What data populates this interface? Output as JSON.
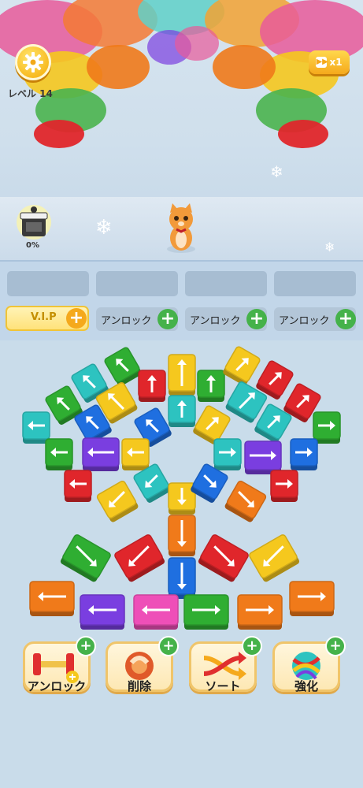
{
  "hud": {
    "settings_icon": "gear-icon",
    "level_label": "レベル 14",
    "speed_label": "x1",
    "speed_icon": "fast-forward-icon",
    "shop_progress": "0%"
  },
  "slots": {
    "count": 4,
    "vip_label": "V.I.P",
    "unlock_label": "アンロック",
    "unlock_buttons": 3
  },
  "tools": [
    {
      "label": "アンロック",
      "icon": "dumbbell-plus-icon"
    },
    {
      "label": "削除",
      "icon": "hand-pointer-icon"
    },
    {
      "label": "ソート",
      "icon": "shuffle-icon"
    },
    {
      "label": "強化",
      "icon": "yarn-ball-icon"
    }
  ],
  "colors": {
    "red": "#e0262b",
    "yellow": "#f5c81e",
    "green": "#2fae32",
    "teal": "#2dc3c0",
    "blue": "#1f6fe0",
    "purple": "#7a3ee0",
    "orange": "#f07a1a",
    "pink": "#ee4fb8",
    "accent_gold": "#f7b71a",
    "plus_green": "#45b24a"
  },
  "board_blocks": [
    {
      "color": "green",
      "dir": "up-left"
    },
    {
      "color": "teal",
      "dir": "up-left"
    },
    {
      "color": "red",
      "dir": "up"
    },
    {
      "color": "yellow",
      "dir": "up"
    },
    {
      "color": "green",
      "dir": "up"
    },
    {
      "color": "yellow",
      "dir": "up-right"
    },
    {
      "color": "red",
      "dir": "up-right"
    },
    {
      "color": "green",
      "dir": "up-left"
    },
    {
      "color": "yellow",
      "dir": "up-left"
    },
    {
      "color": "blue",
      "dir": "up-left"
    },
    {
      "color": "teal",
      "dir": "up"
    },
    {
      "color": "yellow",
      "dir": "up-right"
    },
    {
      "color": "teal",
      "dir": "up-right"
    },
    {
      "color": "red",
      "dir": "up-right"
    },
    {
      "color": "teal",
      "dir": "left"
    },
    {
      "color": "blue",
      "dir": "up-left"
    },
    {
      "color": "teal",
      "dir": "up-right"
    },
    {
      "color": "green",
      "dir": "right"
    },
    {
      "color": "green",
      "dir": "left"
    },
    {
      "color": "purple",
      "dir": "left"
    },
    {
      "color": "yellow",
      "dir": "left"
    },
    {
      "color": "teal",
      "dir": "right"
    },
    {
      "color": "purple",
      "dir": "right"
    },
    {
      "color": "blue",
      "dir": "right"
    },
    {
      "color": "red",
      "dir": "left"
    },
    {
      "color": "yellow",
      "dir": "down-left"
    },
    {
      "color": "teal",
      "dir": "down-left"
    },
    {
      "color": "yellow",
      "dir": "down"
    },
    {
      "color": "blue",
      "dir": "down-right"
    },
    {
      "color": "orange",
      "dir": "down-right"
    },
    {
      "color": "red",
      "dir": "right"
    },
    {
      "color": "orange",
      "dir": "down"
    },
    {
      "color": "green",
      "dir": "down-right"
    },
    {
      "color": "red",
      "dir": "down-left"
    },
    {
      "color": "red",
      "dir": "down-right"
    },
    {
      "color": "yellow",
      "dir": "down-left"
    },
    {
      "color": "blue",
      "dir": "down"
    },
    {
      "color": "orange",
      "dir": "left"
    },
    {
      "color": "purple",
      "dir": "left"
    },
    {
      "color": "pink",
      "dir": "left"
    },
    {
      "color": "green",
      "dir": "right"
    },
    {
      "color": "orange",
      "dir": "right"
    },
    {
      "color": "orange",
      "dir": "right"
    }
  ]
}
